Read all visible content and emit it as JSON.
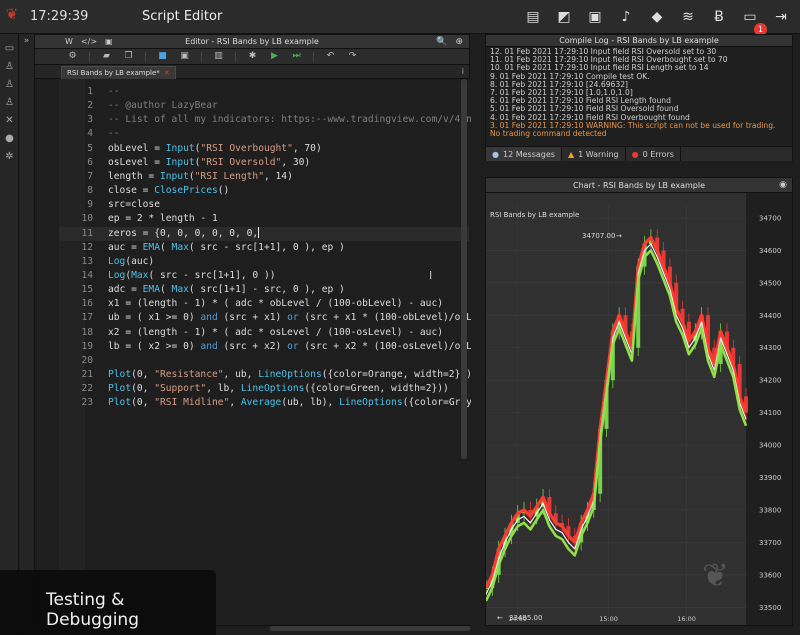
{
  "topbar": {
    "logo_icon": "rabbit-logo-icon",
    "time": "17:29:39",
    "title": "Script Editor",
    "icons": [
      "map-icon",
      "ruler-icon",
      "crop-icon",
      "bell-icon",
      "tag-icon",
      "coins-icon",
      "bitcoin-icon",
      "inbox-icon",
      "logout-icon"
    ],
    "notification_count": "1"
  },
  "sidebar": {
    "icons": [
      "monitor-icon",
      "flask-icon",
      "flask-icon",
      "flask-icon",
      "tools-icon",
      "user-icon",
      "gear-icon"
    ]
  },
  "editor": {
    "title": "Editor - RSI Bands by LB example",
    "title_left": [
      "W",
      "</>",
      "▣"
    ],
    "title_right": [
      "🔍",
      "⊕"
    ],
    "file_tab": "RSI Bands by LB example*",
    "file_tab_close": "✕",
    "info_icon": "i",
    "code": [
      {
        "n": "1",
        "t": "--",
        "c": "cmt"
      },
      {
        "n": "2",
        "t": "-- @author LazyBear",
        "c": "cmt"
      },
      {
        "n": "3",
        "t": "-- List of all my indicators: https:--www.tradingview.com/v/4In",
        "c": "cmt"
      },
      {
        "n": "4",
        "t": "--",
        "c": "cmt"
      },
      {
        "n": "5",
        "parts": [
          [
            "obLevel = ",
            ""
          ],
          [
            "Input",
            "fn"
          ],
          [
            "(",
            ""
          ],
          [
            "\"RSI Overbought\"",
            "str"
          ],
          [
            ", 70)",
            ""
          ]
        ]
      },
      {
        "n": "6",
        "parts": [
          [
            "osLevel = ",
            ""
          ],
          [
            "Input",
            "fn"
          ],
          [
            "(",
            ""
          ],
          [
            "\"RSI Oversold\"",
            "str"
          ],
          [
            ", 30)",
            ""
          ]
        ]
      },
      {
        "n": "7",
        "parts": [
          [
            "length = ",
            ""
          ],
          [
            "Input",
            "fn"
          ],
          [
            "(",
            ""
          ],
          [
            "\"RSI Length\"",
            "str"
          ],
          [
            ", 14)",
            ""
          ]
        ]
      },
      {
        "n": "8",
        "parts": [
          [
            "close = ",
            ""
          ],
          [
            "ClosePrices",
            "fn"
          ],
          [
            "()",
            ""
          ]
        ]
      },
      {
        "n": "9",
        "parts": [
          [
            "src=close",
            ""
          ]
        ]
      },
      {
        "n": "10",
        "parts": [
          [
            "ep = 2 * length - 1",
            ""
          ]
        ]
      },
      {
        "n": "11",
        "parts": [
          [
            "zeros = {0, 0, 0, 0, 0, 0,",
            ""
          ]
        ],
        "active": true
      },
      {
        "n": "12",
        "parts": [
          [
            "auc = ",
            ""
          ],
          [
            "EMA",
            "fn"
          ],
          [
            "( ",
            ""
          ],
          [
            "Max",
            "fn"
          ],
          [
            "( src - src[1+1], 0 ), ep )",
            ""
          ]
        ]
      },
      {
        "n": "13",
        "parts": [
          [
            "Log",
            "fn"
          ],
          [
            "(auc)",
            ""
          ]
        ]
      },
      {
        "n": "14",
        "parts": [
          [
            "Log",
            "fn"
          ],
          [
            "(",
            ""
          ],
          [
            "Max",
            "fn"
          ],
          [
            "( src - src[1+1], 0 ))",
            ""
          ]
        ]
      },
      {
        "n": "15",
        "parts": [
          [
            "adc = ",
            ""
          ],
          [
            "EMA",
            "fn"
          ],
          [
            "( ",
            ""
          ],
          [
            "Max",
            "fn"
          ],
          [
            "( src[1+1] - src, 0 ), ep )",
            ""
          ]
        ]
      },
      {
        "n": "16",
        "parts": [
          [
            "x1 = (length - 1) * ( adc * obLevel / (100-obLevel) - auc)",
            ""
          ]
        ]
      },
      {
        "n": "17",
        "parts": [
          [
            "ub = ( x1 >= 0) ",
            ""
          ],
          [
            "and",
            "kw"
          ],
          [
            " (src + x1) ",
            ""
          ],
          [
            "or",
            "kw"
          ],
          [
            " (src + x1 * (100-obLevel)/obL",
            ""
          ]
        ]
      },
      {
        "n": "18",
        "parts": [
          [
            "x2 = (length - 1) * ( adc * osLevel / (100-osLevel) - auc)",
            ""
          ]
        ]
      },
      {
        "n": "19",
        "parts": [
          [
            "lb = ( x2 >= 0) ",
            ""
          ],
          [
            "and",
            "kw"
          ],
          [
            " (src + x2) ",
            ""
          ],
          [
            "or",
            "kw"
          ],
          [
            " (src + x2 * (100-osLevel)/osL",
            ""
          ]
        ]
      },
      {
        "n": "20",
        "parts": [
          [
            "",
            ""
          ]
        ]
      },
      {
        "n": "21",
        "parts": [
          [
            "Plot",
            "fn"
          ],
          [
            "(0, ",
            ""
          ],
          [
            "\"Resistance\"",
            "str"
          ],
          [
            ", ub, ",
            ""
          ],
          [
            "LineOptions",
            "fn"
          ],
          [
            "({color=Orange, width=2}))",
            ""
          ]
        ]
      },
      {
        "n": "22",
        "parts": [
          [
            "Plot",
            "fn"
          ],
          [
            "(0, ",
            ""
          ],
          [
            "\"Support\"",
            "str"
          ],
          [
            ", lb, ",
            ""
          ],
          [
            "LineOptions",
            "fn"
          ],
          [
            "({color=Green, width=2}))",
            ""
          ]
        ]
      },
      {
        "n": "23",
        "parts": [
          [
            "Plot",
            "fn"
          ],
          [
            "(0, ",
            ""
          ],
          [
            "\"RSI Midline\"",
            "str"
          ],
          [
            ", ",
            ""
          ],
          [
            "Average",
            "fn"
          ],
          [
            "(ub, lb), ",
            ""
          ],
          [
            "LineOptions",
            "fn"
          ],
          [
            "({color=Gray",
            ""
          ]
        ]
      }
    ]
  },
  "log": {
    "title": "Compile Log - RSI Bands by LB example",
    "lines": [
      "12. 01 Feb 2021 17:29:10 Input field RSI Oversold set to 30",
      "11. 01 Feb 2021 17:29:10 Input field RSI Overbought set to 70",
      "10. 01 Feb 2021 17:29:10 Input field RSI Length set to 14",
      "9. 01 Feb 2021 17:29:10 Compile test OK.",
      "8. 01 Feb 2021 17:29:10 [24.69632]",
      "7. 01 Feb 2021 17:29:10 [1.0,1.0,1.0]",
      "6. 01 Feb 2021 17:29:10 Field RSI Length found",
      "5. 01 Feb 2021 17:29:10 Field RSI Oversold found",
      "4. 01 Feb 2021 17:29:10 Field RSI Overbought found"
    ],
    "warning_line": "3. 01 Feb 2021 17:29:10 WARNING: This script can not be used for trading. No trading command detected",
    "messages": "12 Messages",
    "warnings": "1 Warning",
    "errors": "0 Errors"
  },
  "chart": {
    "title": "Chart - RSI Bands by LB example",
    "legend_label": "RSI Bands by LB example",
    "high_label": "34707.00",
    "low_label": "33495.00",
    "y_ticks": [
      "34700",
      "34600",
      "34500",
      "34400",
      "34300",
      "34200",
      "34100",
      "34000",
      "33900",
      "33800",
      "33700",
      "33600",
      "33500"
    ],
    "x_ticks": [
      "14:00",
      "15:00",
      "16:00"
    ]
  },
  "chart_data": {
    "type": "line",
    "title": "RSI Bands by LB example",
    "xlabel": "",
    "ylabel": "",
    "ylim": [
      33470,
      34740
    ],
    "x_ticks": [
      "14:00",
      "15:00",
      "16:00"
    ],
    "annotations": [
      "34707.00",
      "33495.00"
    ],
    "series": [
      {
        "values": [
          33560,
          33600,
          33680,
          33720,
          33760,
          33790,
          33800,
          33780,
          33810,
          33840,
          33790,
          33760,
          33750,
          33720,
          33700,
          33760,
          33800,
          33850,
          34050,
          34200,
          34350,
          34400,
          34350,
          34300,
          34550,
          34620,
          34640,
          34600,
          34550,
          34500,
          34420,
          34380,
          34320,
          34350,
          34400,
          34300,
          34250,
          34350,
          34300,
          34250,
          34150,
          34100
        ]
      },
      {
        "values": [
          33540,
          33580,
          33650,
          33700,
          33740,
          33770,
          33780,
          33760,
          33790,
          33820,
          33770,
          33740,
          33730,
          33700,
          33680,
          33740,
          33780,
          33830,
          34030,
          34180,
          34330,
          34380,
          34330,
          34280,
          34530,
          34600,
          34620,
          34580,
          34530,
          34480,
          34400,
          34360,
          34300,
          34330,
          34380,
          34280,
          34230,
          34330,
          34280,
          34230,
          34130,
          34080
        ]
      },
      {
        "values": [
          33520,
          33560,
          33630,
          33680,
          33720,
          33750,
          33760,
          33740,
          33770,
          33800,
          33750,
          33720,
          33710,
          33680,
          33660,
          33720,
          33760,
          33810,
          34010,
          34160,
          34310,
          34360,
          34310,
          34260,
          34510,
          34580,
          34600,
          34560,
          34510,
          34460,
          34380,
          34340,
          34280,
          34310,
          34360,
          34260,
          34210,
          34310,
          34260,
          34210,
          34110,
          34060
        ]
      }
    ]
  },
  "caption": "Testing & Debugging"
}
